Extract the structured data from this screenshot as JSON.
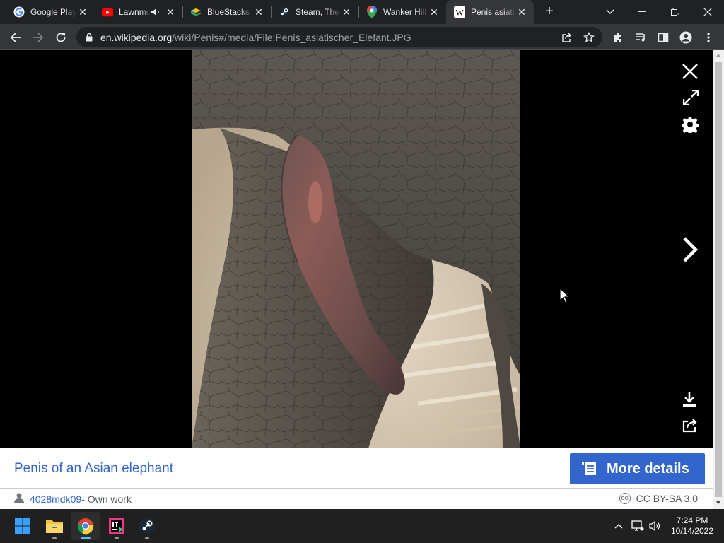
{
  "tabs": [
    {
      "title": "Google Play",
      "icon": "google-icon"
    },
    {
      "title": "Lawnmower",
      "icon": "youtube-icon",
      "audio": true
    },
    {
      "title": "BlueStacks",
      "icon": "bluestacks-icon"
    },
    {
      "title": "Steam, The",
      "icon": "steam-icon"
    },
    {
      "title": "Wanker Hill",
      "icon": "maps-pin-icon"
    },
    {
      "title": "Penis asiatischer",
      "icon": "wikipedia-icon",
      "active": true
    }
  ],
  "address_bar": {
    "host": "en.wikipedia.org",
    "path": "/wiki/Penis#/media/File:Penis_asiatischer_Elefant.JPG"
  },
  "media": {
    "caption": "Penis of an Asian elephant",
    "more_details_label": "More details",
    "author": "4028mdk09",
    "author_suffix": " - Own work",
    "license_badge": "CC",
    "license": "CC BY-SA 3.0"
  },
  "taskbar": {
    "time": "7:24 PM",
    "date": "10/14/2022",
    "apps": [
      "windows-start-icon",
      "file-explorer-icon",
      "chrome-icon",
      "intellij-icon",
      "steam-icon"
    ]
  },
  "colors": {
    "wiki_link": "#3366cc",
    "tab_bg": "#202124",
    "toolbar_bg": "#35363a",
    "taskbar_bg": "#202020",
    "active_indicator": "#4cc2ff"
  }
}
